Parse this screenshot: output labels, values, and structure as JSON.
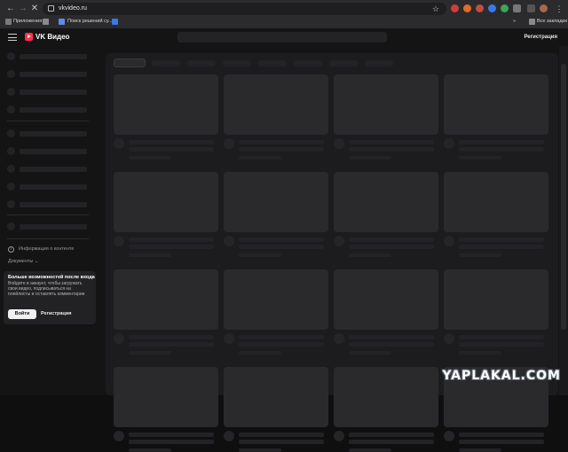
{
  "browser": {
    "url": "vkvideo.ru",
    "bookmarks": {
      "apps_label": "Приложения",
      "item1_label": "Поиск решений су...",
      "all_bookmarks_label": "Все закладки"
    }
  },
  "header": {
    "logo_text": "VK Видео",
    "register_label": "Регистрация"
  },
  "sidebar": {
    "info_label": "Информация о контенте",
    "docs_label": "Документы ⌄"
  },
  "login_card": {
    "title": "Больше возможностей после входа",
    "text": "Войдите в аккаунт, чтобы загружать свои видео, подписываться на плейлисты и оставлять комментарии",
    "login_label": "Войти",
    "register_label": "Регистрация"
  },
  "watermark": "YAPLAKAL.COM",
  "colors": {
    "brand": "#ff3347",
    "background": "#141415",
    "skeleton": "#232326"
  }
}
